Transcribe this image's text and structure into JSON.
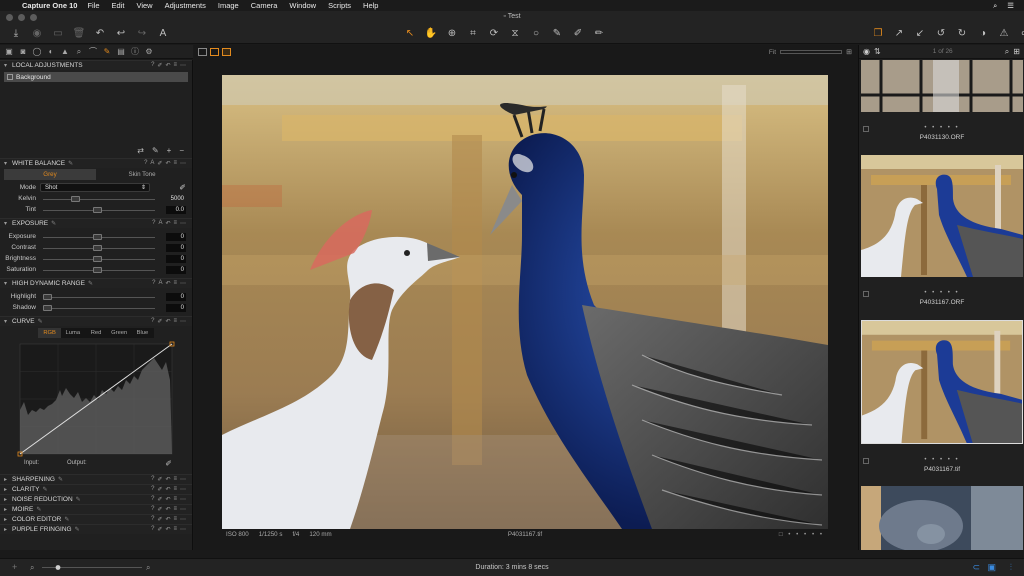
{
  "menubar": {
    "app_name": "Capture One 10",
    "items": [
      "File",
      "Edit",
      "View",
      "Adjustments",
      "Image",
      "Camera",
      "Window",
      "Scripts",
      "Help"
    ]
  },
  "window": {
    "title": "Test"
  },
  "left_tabs_icons": [
    "folder-icon",
    "camera-icon",
    "lens-icon",
    "color-icon",
    "exposure-icon",
    "details-icon",
    "adjust-icon",
    "local-adjustments-icon",
    "output-icon",
    "metadata-icon",
    "batch-icon"
  ],
  "local_adjustments": {
    "title": "LOCAL ADJUSTMENTS",
    "layer_name": "Background"
  },
  "white_balance": {
    "title": "WHITE BALANCE",
    "tabs": [
      "Grey",
      "Skin Tone"
    ],
    "mode_label": "Mode",
    "mode_value": "Shot",
    "kelvin_label": "Kelvin",
    "kelvin_value": "5000",
    "tint_label": "Tint",
    "tint_value": "0.0"
  },
  "exposure": {
    "title": "EXPOSURE",
    "rows": [
      {
        "label": "Exposure",
        "value": "0"
      },
      {
        "label": "Contrast",
        "value": "0"
      },
      {
        "label": "Brightness",
        "value": "0"
      },
      {
        "label": "Saturation",
        "value": "0"
      }
    ]
  },
  "hdr": {
    "title": "HIGH DYNAMIC RANGE",
    "rows": [
      {
        "label": "Highlight",
        "value": "0"
      },
      {
        "label": "Shadow",
        "value": "0"
      }
    ]
  },
  "curve": {
    "title": "CURVE",
    "tabs": [
      "RGB",
      "Luma",
      "Red",
      "Green",
      "Blue"
    ],
    "input_label": "Input:",
    "output_label": "Output:"
  },
  "collapsed_sections": [
    "SHARPENING",
    "CLARITY",
    "NOISE REDUCTION",
    "MOIRE",
    "COLOR EDITOR",
    "PURPLE FRINGING"
  ],
  "viewer": {
    "fit_label": "Fit",
    "meta": {
      "iso": "ISO 800",
      "shutter": "1/1250 s",
      "aperture": "f/4",
      "focal": "120 mm",
      "filename": "P4031167.tif"
    }
  },
  "browser": {
    "counter": "1 of 26",
    "thumbs": [
      {
        "label": "P4031130.ORF"
      },
      {
        "label": "P4031167.ORF"
      },
      {
        "label": "P4031167.tif"
      }
    ]
  },
  "status": {
    "duration": "Duration: 3 mins 8 secs"
  },
  "colors": {
    "accent": "#e28a1e",
    "panel": "#202020",
    "background": "#1a1a1a"
  }
}
